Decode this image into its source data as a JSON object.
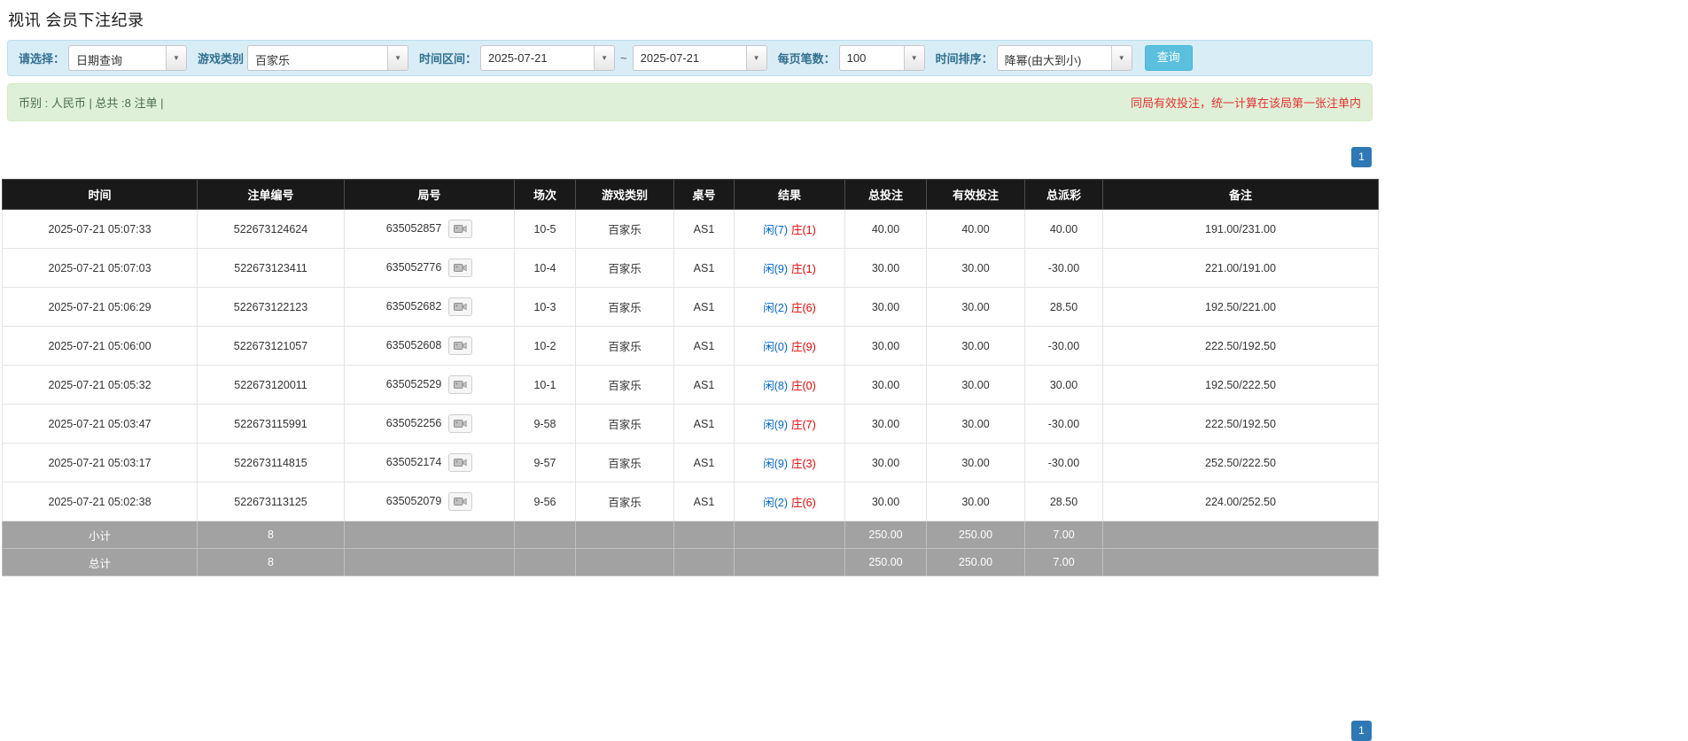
{
  "page": {
    "title": "视讯 会员下注纪录"
  },
  "icons": {
    "dropdown_arrow": "▼"
  },
  "filters": {
    "select_label": "请选择：",
    "select_value": "日期查询",
    "game_type_label": "游戏类别",
    "game_type_value": "百家乐",
    "date_range_label": "时间区间：",
    "date_from": "2025-07-21",
    "date_separator": "~",
    "date_to": "2025-07-21",
    "page_size_label": "每页笔数：",
    "page_size_value": "100",
    "sort_label": "时间排序：",
    "sort_value": "降幂(由大到小)",
    "search_button": "查询"
  },
  "summary": {
    "left_text": "币别 : 人民币 | 总共 :8 注单 |",
    "right_notice": "同局有效投注，统一计算在该局第一张注单内"
  },
  "pagination": {
    "page": "1"
  },
  "table": {
    "headers": [
      "时间",
      "注单编号",
      "局号",
      "场次",
      "游戏类别",
      "桌号",
      "结果",
      "总投注",
      "有效投注",
      "总派彩",
      "备注"
    ],
    "rows": [
      {
        "time": "2025-07-21 05:07:33",
        "bet_id": "522673124624",
        "round_id": "635052857",
        "session": "10-5",
        "game": "百家乐",
        "table_no": "AS1",
        "player": "闲(7)",
        "banker": "庄(1)",
        "total_bet": "40.00",
        "valid_bet": "40.00",
        "payout": "40.00",
        "remark": "191.00/231.00"
      },
      {
        "time": "2025-07-21 05:07:03",
        "bet_id": "522673123411",
        "round_id": "635052776",
        "session": "10-4",
        "game": "百家乐",
        "table_no": "AS1",
        "player": "闲(9)",
        "banker": "庄(1)",
        "total_bet": "30.00",
        "valid_bet": "30.00",
        "payout": "-30.00",
        "remark": "221.00/191.00"
      },
      {
        "time": "2025-07-21 05:06:29",
        "bet_id": "522673122123",
        "round_id": "635052682",
        "session": "10-3",
        "game": "百家乐",
        "table_no": "AS1",
        "player": "闲(2)",
        "banker": "庄(6)",
        "total_bet": "30.00",
        "valid_bet": "30.00",
        "payout": "28.50",
        "remark": "192.50/221.00"
      },
      {
        "time": "2025-07-21 05:06:00",
        "bet_id": "522673121057",
        "round_id": "635052608",
        "session": "10-2",
        "game": "百家乐",
        "table_no": "AS1",
        "player": "闲(0)",
        "banker": "庄(9)",
        "total_bet": "30.00",
        "valid_bet": "30.00",
        "payout": "-30.00",
        "remark": "222.50/192.50"
      },
      {
        "time": "2025-07-21 05:05:32",
        "bet_id": "522673120011",
        "round_id": "635052529",
        "session": "10-1",
        "game": "百家乐",
        "table_no": "AS1",
        "player": "闲(8)",
        "banker": "庄(0)",
        "total_bet": "30.00",
        "valid_bet": "30.00",
        "payout": "30.00",
        "remark": "192.50/222.50"
      },
      {
        "time": "2025-07-21 05:03:47",
        "bet_id": "522673115991",
        "round_id": "635052256",
        "session": "9-58",
        "game": "百家乐",
        "table_no": "AS1",
        "player": "闲(9)",
        "banker": "庄(7)",
        "total_bet": "30.00",
        "valid_bet": "30.00",
        "payout": "-30.00",
        "remark": "222.50/192.50"
      },
      {
        "time": "2025-07-21 05:03:17",
        "bet_id": "522673114815",
        "round_id": "635052174",
        "session": "9-57",
        "game": "百家乐",
        "table_no": "AS1",
        "player": "闲(9)",
        "banker": "庄(3)",
        "total_bet": "30.00",
        "valid_bet": "30.00",
        "payout": "-30.00",
        "remark": "252.50/222.50"
      },
      {
        "time": "2025-07-21 05:02:38",
        "bet_id": "522673113125",
        "round_id": "635052079",
        "session": "9-56",
        "game": "百家乐",
        "table_no": "AS1",
        "player": "闲(2)",
        "banker": "庄(6)",
        "total_bet": "30.00",
        "valid_bet": "30.00",
        "payout": "28.50",
        "remark": "224.00/252.50"
      }
    ],
    "subtotal": {
      "label": "小计",
      "count": "8",
      "total_bet": "250.00",
      "valid_bet": "250.00",
      "payout": "7.00"
    },
    "total": {
      "label": "总计",
      "count": "8",
      "total_bet": "250.00",
      "valid_bet": "250.00",
      "payout": "7.00"
    }
  }
}
